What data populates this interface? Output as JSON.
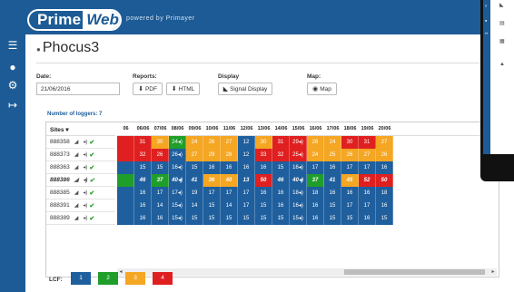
{
  "brand": {
    "prime": "Prime",
    "web": "Web",
    "powered": "powered by Primayer"
  },
  "sidebar": {
    "icons": [
      "menu-icon",
      "globe-icon",
      "settings-icon",
      "logout-icon"
    ],
    "glyphs": [
      "☰",
      "●",
      "⚙",
      "↦"
    ]
  },
  "page": {
    "title": "Phocus3"
  },
  "controls": {
    "date_label": "Date:",
    "date_value": "21/06/2016",
    "reports_label": "Reports:",
    "pdf_label": "PDF",
    "html_label": "HTML",
    "display_label": "Display",
    "signal_display_label": "Signal Display",
    "map_label": "Map:",
    "map_button_label": "Map"
  },
  "loggers_label": "Number of loggers: 7",
  "table": {
    "sites_header": "Sites",
    "days": [
      "06",
      "06/06",
      "07/06",
      "08/06",
      "09/06",
      "10/06",
      "11/06",
      "12/06",
      "13/06",
      "14/06",
      "15/06",
      "16/06",
      "17/06",
      "18/06",
      "19/06",
      "20/06"
    ],
    "rows": [
      {
        "site": "888358",
        "bold": false,
        "cells": [
          [
            "c4",
            ""
          ],
          [
            "c4",
            "31"
          ],
          [
            "c3",
            "30"
          ],
          [
            "c2",
            "24◂)"
          ],
          [
            "c3",
            "24"
          ],
          [
            "c3",
            "26"
          ],
          [
            "c3",
            "27"
          ],
          [
            "c1",
            "12"
          ],
          [
            "c3",
            "30"
          ],
          [
            "c4",
            "31"
          ],
          [
            "c4",
            "29◂)"
          ],
          [
            "c3",
            "28"
          ],
          [
            "c3",
            "24"
          ],
          [
            "c4",
            "30"
          ],
          [
            "c4",
            "31"
          ],
          [
            "c3",
            "27"
          ]
        ]
      },
      {
        "site": "888373",
        "bold": false,
        "cells": [
          [
            "c4",
            ""
          ],
          [
            "c4",
            "32"
          ],
          [
            "c4",
            "26"
          ],
          [
            "c1",
            "26◂)"
          ],
          [
            "c3",
            "27"
          ],
          [
            "c3",
            "29"
          ],
          [
            "c3",
            "28"
          ],
          [
            "c1",
            "12"
          ],
          [
            "c4",
            "33"
          ],
          [
            "c4",
            "32"
          ],
          [
            "c4",
            "25◂)"
          ],
          [
            "c3",
            "24"
          ],
          [
            "c3",
            "25"
          ],
          [
            "c3",
            "26"
          ],
          [
            "c3",
            "27"
          ],
          [
            "c3",
            "26"
          ]
        ]
      },
      {
        "site": "888363",
        "bold": false,
        "cells": [
          [
            "c1",
            ""
          ],
          [
            "c1",
            "15"
          ],
          [
            "c1",
            "15"
          ],
          [
            "c1",
            "16◂)"
          ],
          [
            "c1",
            "15"
          ],
          [
            "c1",
            "16"
          ],
          [
            "c1",
            "16"
          ],
          [
            "c1",
            "16"
          ],
          [
            "c1",
            "16"
          ],
          [
            "c1",
            "15"
          ],
          [
            "c1",
            "16◂)"
          ],
          [
            "c1",
            "17"
          ],
          [
            "c1",
            "16"
          ],
          [
            "c1",
            "17"
          ],
          [
            "c1",
            "17"
          ],
          [
            "c1",
            "16"
          ]
        ]
      },
      {
        "site": "888386",
        "bold": true,
        "cells": [
          [
            "c2",
            ""
          ],
          [
            "c1",
            "46"
          ],
          [
            "c2",
            "37"
          ],
          [
            "c1",
            "40◂)"
          ],
          [
            "c1",
            "41"
          ],
          [
            "c3",
            "36"
          ],
          [
            "c3",
            "40"
          ],
          [
            "c1",
            "13"
          ],
          [
            "c4",
            "50"
          ],
          [
            "c1",
            "46"
          ],
          [
            "c1",
            "40◂)"
          ],
          [
            "c2",
            "37"
          ],
          [
            "c1",
            "41"
          ],
          [
            "c3",
            "45"
          ],
          [
            "c4",
            "52"
          ],
          [
            "c4",
            "50"
          ]
        ]
      },
      {
        "site": "888385",
        "bold": false,
        "cells": [
          [
            "c1",
            ""
          ],
          [
            "c1",
            "16"
          ],
          [
            "c1",
            "17"
          ],
          [
            "c1",
            "17◂)"
          ],
          [
            "c1",
            "19"
          ],
          [
            "c1",
            "17"
          ],
          [
            "c1",
            "17"
          ],
          [
            "c1",
            "17"
          ],
          [
            "c1",
            "16"
          ],
          [
            "c1",
            "16"
          ],
          [
            "c1",
            "18◂)"
          ],
          [
            "c1",
            "18"
          ],
          [
            "c1",
            "16"
          ],
          [
            "c1",
            "16"
          ],
          [
            "c1",
            "16"
          ],
          [
            "c1",
            "18"
          ]
        ]
      },
      {
        "site": "888391",
        "bold": false,
        "cells": [
          [
            "c1",
            ""
          ],
          [
            "c1",
            "16"
          ],
          [
            "c1",
            "14"
          ],
          [
            "c1",
            "15◂)"
          ],
          [
            "c1",
            "14"
          ],
          [
            "c1",
            "15"
          ],
          [
            "c1",
            "14"
          ],
          [
            "c1",
            "17"
          ],
          [
            "c1",
            "15"
          ],
          [
            "c1",
            "16"
          ],
          [
            "c1",
            "16◂)"
          ],
          [
            "c1",
            "16"
          ],
          [
            "c1",
            "15"
          ],
          [
            "c1",
            "17"
          ],
          [
            "c1",
            "17"
          ],
          [
            "c1",
            "16"
          ]
        ]
      },
      {
        "site": "888389",
        "bold": false,
        "cells": [
          [
            "c1",
            ""
          ],
          [
            "c1",
            "16"
          ],
          [
            "c1",
            "16"
          ],
          [
            "c1",
            "15◂)"
          ],
          [
            "c1",
            "15"
          ],
          [
            "c1",
            "15"
          ],
          [
            "c1",
            "15"
          ],
          [
            "c1",
            "15"
          ],
          [
            "c1",
            "15"
          ],
          [
            "c1",
            "15"
          ],
          [
            "c1",
            "15◂)"
          ],
          [
            "c1",
            "16"
          ],
          [
            "c1",
            "15"
          ],
          [
            "c1",
            "15"
          ],
          [
            "c1",
            "16"
          ],
          [
            "c1",
            "15"
          ]
        ]
      }
    ]
  },
  "legend": {
    "label": "LCF:",
    "items": [
      "1",
      "2",
      "3",
      "4"
    ]
  },
  "colors": {
    "c1": "#1f5f9e",
    "c2": "#1f9e2a",
    "c3": "#f5a623",
    "c4": "#e02020",
    "brand": "#1d5b96"
  }
}
